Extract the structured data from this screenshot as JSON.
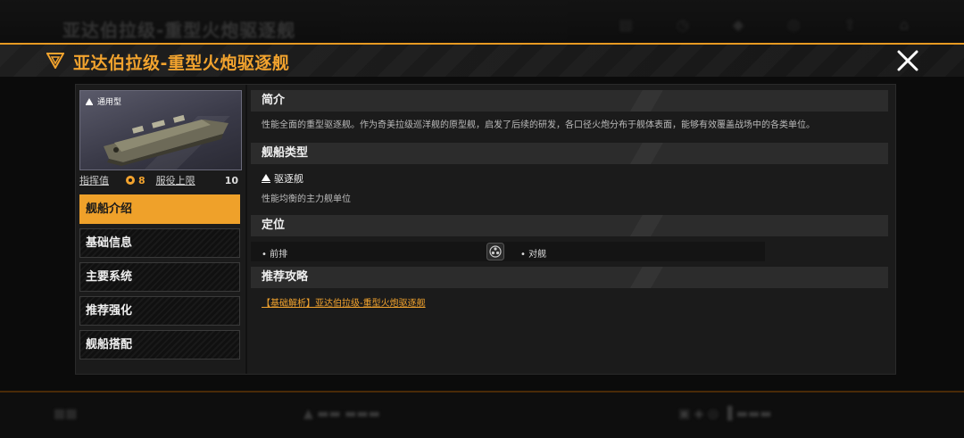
{
  "background": {
    "top_ghost_title": "亚达伯拉级-重型火炮驱逐舰"
  },
  "header": {
    "title": "亚达伯拉级-重型火炮驱逐舰"
  },
  "ship_card": {
    "tag": "通用型",
    "command_label": "指挥值",
    "command_value": "8",
    "service_label": "服役上限",
    "service_value": "10"
  },
  "nav": {
    "items": [
      {
        "label": "舰船介绍",
        "active": true
      },
      {
        "label": "基础信息",
        "active": false
      },
      {
        "label": "主要系统",
        "active": false
      },
      {
        "label": "推荐强化",
        "active": false
      },
      {
        "label": "舰船搭配",
        "active": false
      }
    ]
  },
  "sections": {
    "intro_title": "简介",
    "intro_text": "性能全面的重型驱逐舰。作为奇美拉级巡洋舰的原型舰，启发了后续的研发，各口径火炮分布于舰体表面，能够有效覆盖战场中的各类单位。",
    "type_title": "舰船类型",
    "type_name": "驱逐舰",
    "type_desc": "性能均衡的主力舰单位",
    "position_title": "定位",
    "position_1": "• 前排",
    "position_2": "• 对舰",
    "guide_title": "推荐攻略",
    "guide_link": "【基础解析】亚达伯拉级-重型火炮驱逐舰"
  },
  "colors": {
    "accent": "#efa12a",
    "panel": "#1b1b1b"
  },
  "icons": [
    "triangle-emblem-icon",
    "close-icon",
    "ship-class-icon",
    "command-icon",
    "anti-ship-icon"
  ]
}
